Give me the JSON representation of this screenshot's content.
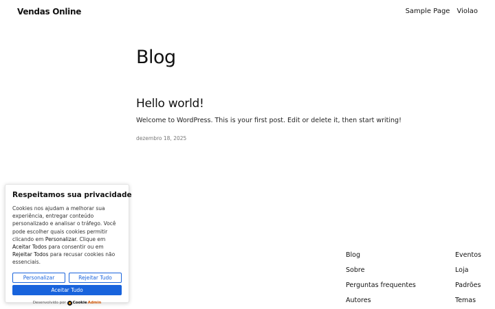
{
  "header": {
    "site_title": "Vendas Online",
    "nav": [
      "Sample Page",
      "Violao"
    ]
  },
  "main": {
    "heading": "Blog",
    "post": {
      "title": "Hello world!",
      "excerpt": "Welcome to WordPress. This is your first post. Edit or delete it, then start writing!",
      "date": "dezembro 18, 2025"
    }
  },
  "footer": {
    "col1": [
      "Blog",
      "Sobre",
      "Perguntas frequentes",
      "Autores"
    ],
    "col2": [
      "Eventos",
      "Loja",
      "Padrões",
      "Temas"
    ]
  },
  "cookie_banner": {
    "title": "Respeitamos sua privacidade",
    "body_part1": "Cookies nos ajudam a melhorar sua experiência, entregar conteúdo personalizado e analisar o tráfego. Você pode escolher quais cookies permitir clicando em ",
    "body_emph1": "Personalizar",
    "body_part2": ". Clique em ",
    "body_emph2": "Aceitar Todos",
    "body_part3": " para consentir ou em ",
    "body_emph3": "Rejeitar Todos",
    "body_part4": " para recusar cookies não essenciais.",
    "customize_label": "Personalizar",
    "reject_label": "Rejeitar Tudo",
    "accept_label": "Aceitar Tudo",
    "powered_by": "Desenvolvido por",
    "brand_name_1": "Cookie",
    "brand_name_2": "Admin",
    "accent_color": "#1863dc"
  }
}
